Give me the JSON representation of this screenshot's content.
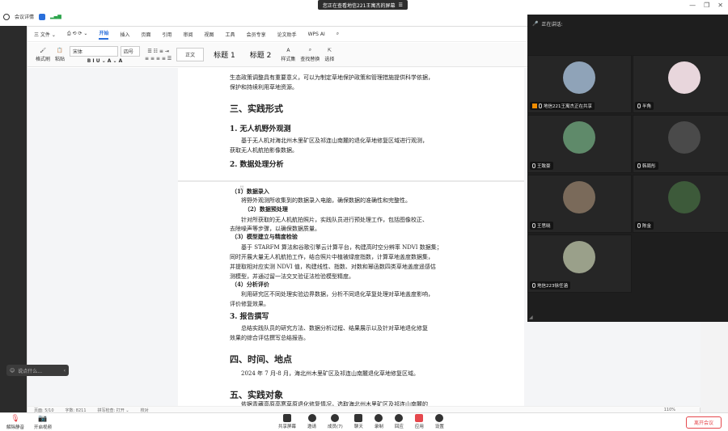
{
  "share_banner": {
    "text": "您正在查看地信221王寓杰的屏幕",
    "icon": "screen-share-icon"
  },
  "meeting": {
    "info_label": "会议详情"
  },
  "wps": {
    "menu": [
      "三 文件 ⌄",
      "开始",
      "插入",
      "页面",
      "引用",
      "审阅",
      "视图",
      "工具",
      "会员专享",
      "论文助手",
      "WPS AI"
    ],
    "active_tab": "开始",
    "ribbon": {
      "format_painter": "格式刷",
      "paste": "粘贴",
      "font_name": "宋体",
      "font_size": "四号",
      "style_body": "正文",
      "heading1": "标题 1",
      "heading2": "标题 2",
      "styles_label": "样式集",
      "find_replace": "查找替换",
      "select": "选择"
    },
    "status": {
      "page": "页面: 5/10",
      "words": "字数: 8211",
      "spell": "拼写检查: 打开 ⌄",
      "proof": "校对",
      "zoom": "110%"
    }
  },
  "doc": {
    "intro_line1": "生态政策调整具有重要意义，可以为制定草地保护政策和管理措施提供科学依据，",
    "intro_line2": "保护和持续利用草地资源。",
    "sec3_title": "三、实践形式",
    "s1_title": "1. 无人机野外观测",
    "s1_p1": "基于无人机对海北州木里矿区及祁连山南麓的退化草地修复区域进行观测，",
    "s1_p2": "获取无人机航拍影像数据。",
    "s2_title": "2. 数据处理分析",
    "d1_title": "（1）数据录入",
    "d1_text": "将野外观测所收集到的数据录入电脑，确保数据的准确性和完整性。",
    "d2_title": "（2）数据预处理",
    "d2_text1": "针对所获取的无人机航拍照片，实践队员进行预处理工作，包括图像校正、",
    "d2_text2": "去除噪声等步骤，以确保数据质量。",
    "d3_title": "（3）模型建立与精度检验",
    "d3_text1": "基于 STARFM 算法和谷歌引擎云计算平台，构建高时空分辨率 NDVI 数据集；",
    "d3_text2": "同时开展大量无人机航拍工作，结合照片中植被绿度指数，计算草地盖度数据集，",
    "d3_text3": "并提取相对应实测 NDVI 值，构建线性、指数、对数和幂函数四类草地盖度遥感估",
    "d3_text4": "测模型，并通过留一法交叉验证法检验模型精度。",
    "d4_title": "（4）分析评价",
    "d4_text1": "利用研究区不同处理实验边界数据，分析不同退化草复处理对草地盖度影响，",
    "d4_text2": "评价修复效果。",
    "s3_title": "3. 报告撰写",
    "s3_p1": "总结实践队员的研究方法、数据分析过程、结果展示以及针对草地退化修复",
    "s3_p2": "效果的综合评估撰写总结报告。",
    "sec4_title": "四、时间、地点",
    "sec4_text": "2024 年 7 月-8 月，海北州木里矿区及祁连山南麓退化草地修复区域。",
    "sec5_title": "五、实践对象",
    "sec5_text": "依据青藏高原高寒草原退化修复情况，选取海北州木里矿区及祁连山南麓的"
  },
  "chat": {
    "placeholder": "说点什么..."
  },
  "panel": {
    "speaking_label": "正在讲话:",
    "participants": [
      {
        "name": "地信221王寓杰正在共享",
        "avatar_color": "#8fa3b8",
        "badge": "host"
      },
      {
        "name": "半角",
        "avatar_color": "#e8d6dc"
      },
      {
        "name": "王致豪",
        "avatar_color": "#5f8a6a"
      },
      {
        "name": "韩周彤",
        "avatar_color": "#4a4a4a"
      },
      {
        "name": "王思晓",
        "avatar_color": "#7a6a5a"
      },
      {
        "name": "陈金",
        "avatar_color": "#3d5a3a"
      },
      {
        "name": "地信223徐任涵",
        "avatar_color": "#9aa08a"
      }
    ]
  },
  "toolbar": {
    "left": [
      {
        "label": "解除静音",
        "icon": "mic-muted-icon"
      },
      {
        "label": "开启视频",
        "icon": "camera-off-icon"
      }
    ],
    "center": [
      {
        "label": "共享屏幕",
        "icon": "share-screen-icon"
      },
      {
        "label": "邀请",
        "icon": "invite-icon"
      },
      {
        "label": "成员(7)",
        "icon": "members-icon"
      },
      {
        "label": "聊天",
        "icon": "chat-icon"
      },
      {
        "label": "录制",
        "icon": "record-icon"
      },
      {
        "label": "回应",
        "icon": "reaction-icon"
      },
      {
        "label": "应用",
        "icon": "apps-icon"
      },
      {
        "label": "设置",
        "icon": "settings-icon"
      }
    ],
    "leave": "离开会议",
    "accent": "#e5484d"
  }
}
